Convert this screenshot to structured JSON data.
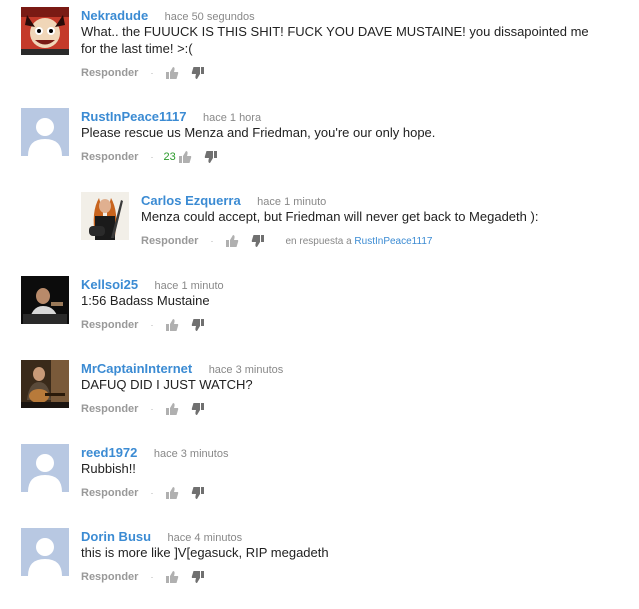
{
  "actions": {
    "reply_label": "Responder",
    "separator": "·"
  },
  "comments": [
    {
      "author": "Nekradude",
      "time": "hace 50 segundos",
      "text": "What.. the FUUUCK IS THIS SHIT! FUCK YOU DAVE MUSTAINE! you dissapointed me for the last time! >:(",
      "avatar": "cartoon-avatar"
    },
    {
      "author": "RustInPeace1117",
      "time": "hace 1 hora",
      "text": "Please rescue us Menza and Friedman, you're our only hope.",
      "score": "23",
      "avatar": "default-avatar"
    },
    {
      "author": "Carlos Ezquerra",
      "time": "hace 1 minuto",
      "text": "Menza could accept, but Friedman will never get back to Megadeth ):",
      "in_reply_prefix": "en respuesta a",
      "in_reply_to": "RustInPeace1117",
      "avatar": "guitarist-photo-avatar"
    },
    {
      "author": "Kellsoi25",
      "time": "hace 1 minuto",
      "text": "1:56 Badass Mustaine",
      "avatar": "dark-photo-avatar"
    },
    {
      "author": "MrCaptainInternet",
      "time": "hace 3 minutos",
      "text": "DAFUQ DID I JUST WATCH?",
      "avatar": "guitar-player-photo-avatar"
    },
    {
      "author": "reed1972",
      "time": "hace 3 minutos",
      "text": "Rubbish!!",
      "avatar": "default-avatar"
    },
    {
      "author": "Dorin Busu",
      "time": "hace 4 minutos",
      "text": "this is more like ]V[egasuck, RIP megadeth",
      "avatar": "default-avatar"
    }
  ],
  "colors": {
    "author_link": "#3b8bd3",
    "timestamp": "#888888",
    "comment_text": "#222222",
    "action_gray": "#999999",
    "score_green": "#2a9a2a",
    "default_avatar_bg": "#b8c8e2"
  }
}
